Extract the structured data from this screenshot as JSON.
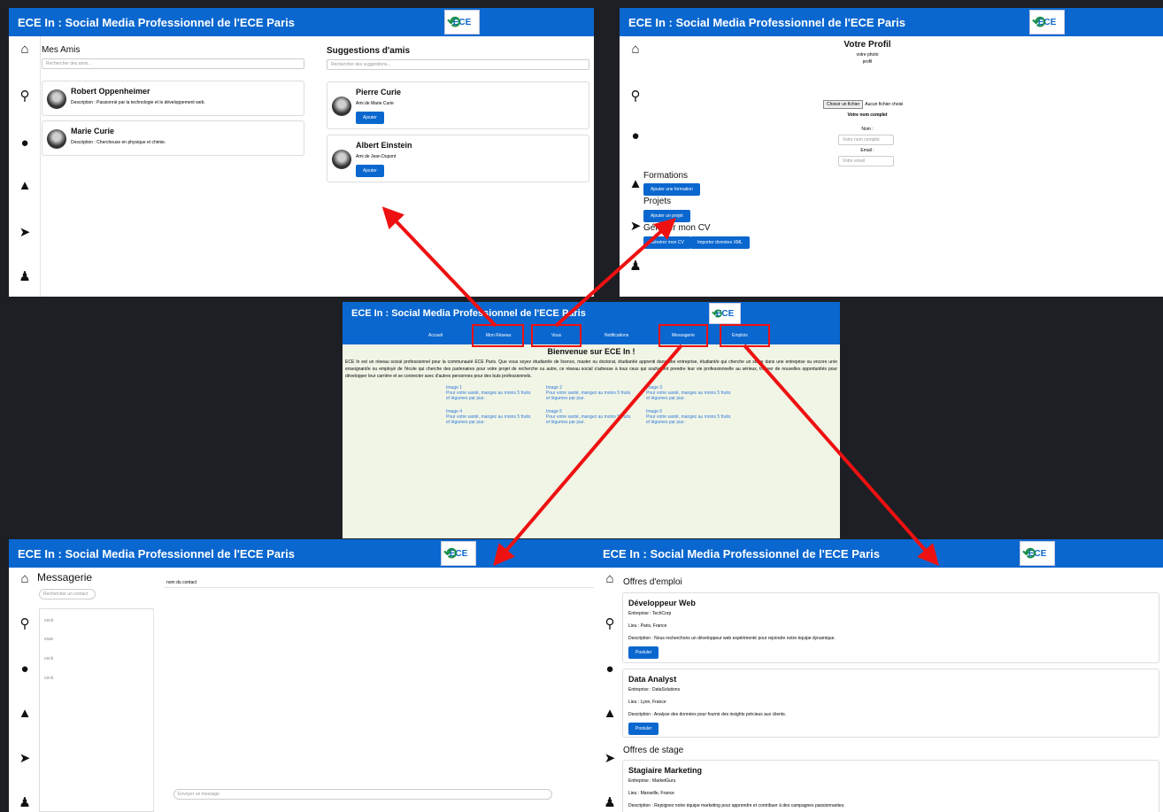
{
  "app_title": "ECE In : Social Media Professionnel de l'ECE Paris",
  "logo_text": "ECE",
  "friends_panel": {
    "my_friends_title": "Mes Amis",
    "search_friends_placeholder": "Rechercher des amis...",
    "friends": [
      {
        "name": "Robert Oppenheimer",
        "desc": "Description : Passionné par la technologie et le développement web."
      },
      {
        "name": "Marie Curie",
        "desc": "Description : Chercheuse en physique et chimie."
      }
    ],
    "suggestions_title": "Suggestions d'amis",
    "search_suggestions_placeholder": "Rechercher des suggestions...",
    "suggestions": [
      {
        "name": "Pierre Curie",
        "mutual": "Ami de Marie Curie",
        "button": "Ajouter"
      },
      {
        "name": "Albert Einstein",
        "mutual": "Ami de Jean Dupont",
        "button": "Ajouter"
      }
    ]
  },
  "profile_panel": {
    "title": "Votre Profil",
    "photo_label": "votre photo",
    "profile_label": "profil",
    "choose_file": "Choisir un fichier",
    "no_file": "Aucun fichier choisi",
    "full_name": "Votre nom complet",
    "name_label": "Nom :",
    "name_placeholder": "Votre nom complet",
    "email_label": "Email :",
    "email_placeholder": "Votre email",
    "formations_title": "Formations",
    "add_formation": "Ajouter une formation",
    "projets_title": "Projets",
    "add_project": "Ajouter un projet",
    "cv_title": "Générer mon CV",
    "generate_cv": "Générer mon CV",
    "import_xml": "Importer données XML"
  },
  "home_panel": {
    "nav": [
      "Accueil",
      "Mon Réseau",
      "Vous",
      "Notifications",
      "Messagerie",
      "Emplois"
    ],
    "welcome": "Bienvenue sur ECE In !",
    "intro": "ECE In est un réseau social professionnel pour la communauté ECE Paris. Que vous soyez étudiant/e de licence, master ou doctorat, étudiant/e apprenti dans une entreprise, étudiant/e qui cherche un stage dans une entreprise ou encore un/e enseignant/e ou employé de l'école qui cherche des partenaires pour votre projet de recherche ou autre, ce réseau social s'adresse à tous ceux qui souhaitent prendre leur vie professionnelle au sérieux, trouver de nouvelles opportunités pour développer leur carrière et se connecter avec d'autres personnes pour des buts professionnels.",
    "gallery": [
      {
        "img": "Image 1",
        "text": "Pour votre santé, mangez au moins 5 fruits et légumes par jour."
      },
      {
        "img": "Image 2",
        "text": "Pour votre santé, mangez au moins 5 fruits et légumes par jour."
      },
      {
        "img": "Image 3",
        "text": "Pour votre santé, mangez au moins 5 fruits et légumes par jour."
      },
      {
        "img": "Image 4",
        "text": "Pour votre santé, mangez au moins 5 fruits et légumes par jour."
      },
      {
        "img": "Image 5",
        "text": "Pour votre santé, mangez au moins 5 fruits et légumes par jour."
      },
      {
        "img": "Image 6",
        "text": "Pour votre santé, mangez au moins 5 fruits et légumes par jour."
      }
    ]
  },
  "messages_panel": {
    "title": "Messagerie",
    "search_contact_placeholder": "Rechercher un contact",
    "contacts": [
      "ceck",
      "esac",
      "ceck",
      "ceck"
    ],
    "contact_name": "nom du contact",
    "message_placeholder": "Envoyer un message"
  },
  "jobs_panel": {
    "jobs_title": "Offres d'emploi",
    "jobs": [
      {
        "title": "Développeur Web",
        "company": "Entreprise : TechCorp",
        "place": "Lieu : Paris, France",
        "desc": "Description : Nous recherchons un développeur web expérimenté pour rejoindre notre équipe dynamique.",
        "button": "Postuler"
      },
      {
        "title": "Data Analyst",
        "company": "Entreprise : DataSolutions",
        "place": "Lieu : Lyon, France",
        "desc": "Description : Analyse des données pour fournir des insights précieux aux clients.",
        "button": "Postuler"
      }
    ],
    "internships_title": "Offres de stage",
    "internships": [
      {
        "title": "Stagiaire Marketing",
        "company": "Entreprise : MarketGuru",
        "place": "Lieu : Marseille, France",
        "desc": "Description : Rejoignez notre équipe marketing pour apprendre et contribuer à des campagnes passionnantes."
      }
    ]
  }
}
